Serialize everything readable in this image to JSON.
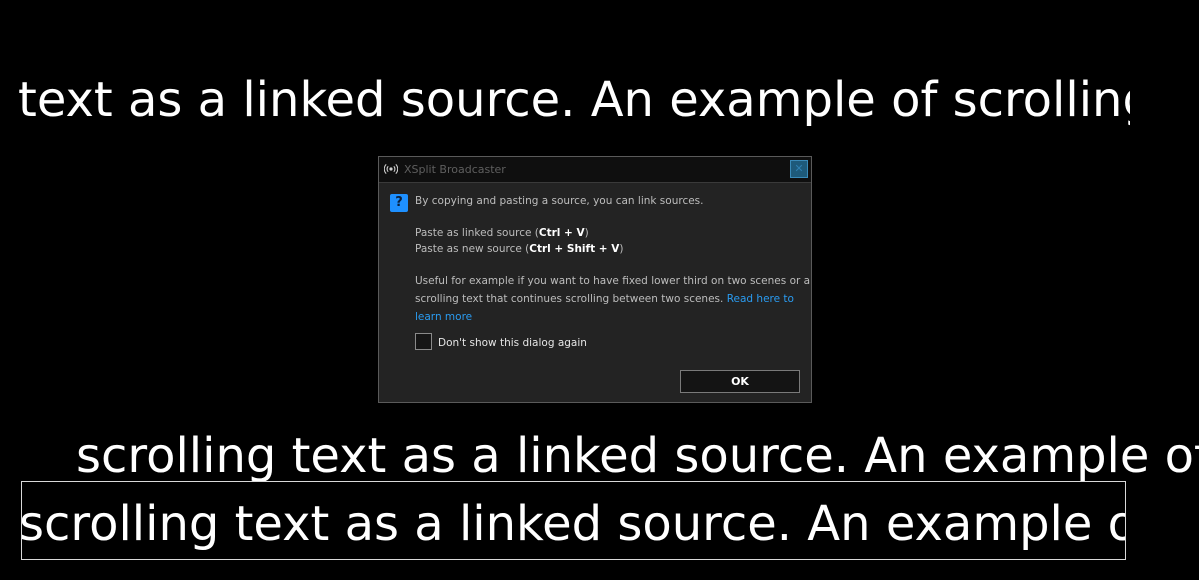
{
  "scrolling_text": {
    "line1": "text as a linked source.  An example of scrolling",
    "line2": "scrolling text as a linked source.  An example of",
    "line3": "scrolling text as a linked source.  An example of"
  },
  "dialog": {
    "app_icon": "broadcast-icon",
    "title": "XSplit Broadcaster",
    "close_icon": "close-icon",
    "question_icon": "?",
    "intro": "By copying and pasting a source, you can link sources.",
    "paste_linked_prefix": "Paste as linked source (",
    "paste_linked_shortcut": "Ctrl + V",
    "paste_linked_suffix": ")",
    "paste_new_prefix": "Paste as new source (",
    "paste_new_shortcut": "Ctrl + Shift + V",
    "paste_new_suffix": ")",
    "useful_line1": "Useful for example if you want to have fixed lower third on two scenes or a",
    "useful_line2": "scrolling text that continues scrolling between two scenes.",
    "link_part1": "Read here to",
    "link_part2": "learn more",
    "checkbox_label": "Don't show this dialog again",
    "checkbox_checked": false,
    "ok_label": "OK"
  },
  "colors": {
    "background": "#000000",
    "dialog_bg": "#232323",
    "titlebar_bg": "#0f0f0f",
    "link": "#2a9bf0",
    "question_icon": "#1e90ff"
  }
}
